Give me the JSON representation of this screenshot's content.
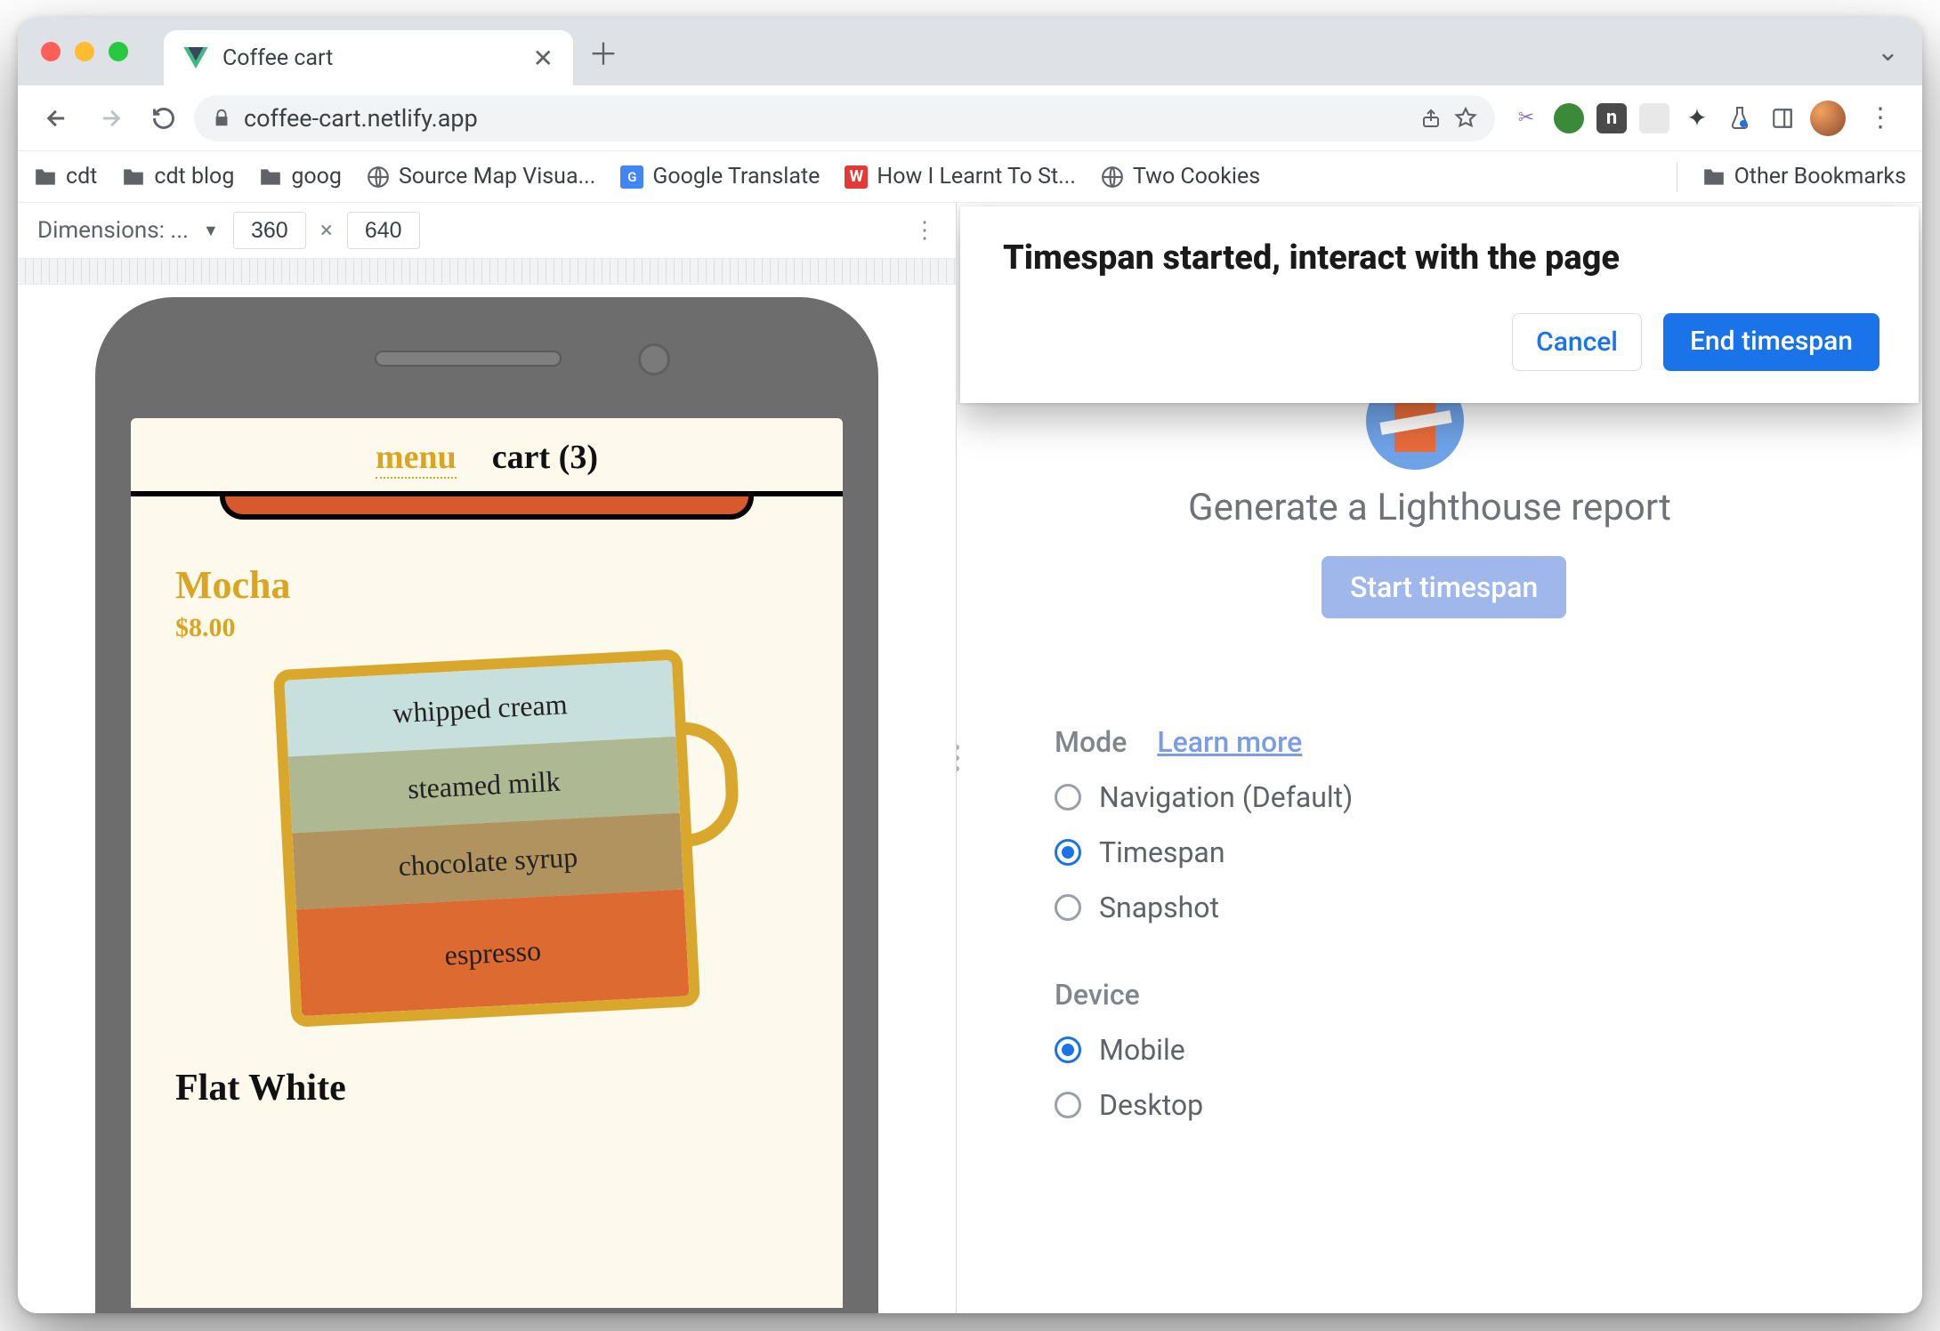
{
  "tab": {
    "title": "Coffee cart"
  },
  "url": "coffee-cart.netlify.app",
  "bookmarks": {
    "items": [
      "cdt",
      "cdt blog",
      "goog",
      "Source Map Visua...",
      "Google Translate",
      "How I Learnt To St...",
      "Two Cookies"
    ],
    "other": "Other Bookmarks"
  },
  "devicebar": {
    "label": "Dimensions: ...",
    "width": "360",
    "height": "640"
  },
  "app": {
    "nav": {
      "menu": "menu",
      "cart": "cart (3)"
    },
    "product1": {
      "title": "Mocha",
      "price": "$8.00",
      "layers": [
        "whipped cream",
        "steamed milk",
        "chocolate syrup",
        "espresso"
      ]
    },
    "product2": {
      "title": "Flat White"
    }
  },
  "lighthouse": {
    "heading": "Generate a Lighthouse report",
    "start": "Start timespan",
    "mode_label": "Mode",
    "learn_more": "Learn more",
    "modes": [
      "Navigation (Default)",
      "Timespan",
      "Snapshot"
    ],
    "mode_selected_index": 1,
    "device_label": "Device",
    "devices": [
      "Mobile",
      "Desktop"
    ],
    "device_selected_index": 0
  },
  "dialog": {
    "title": "Timespan started, interact with the page",
    "cancel": "Cancel",
    "end": "End timespan"
  }
}
